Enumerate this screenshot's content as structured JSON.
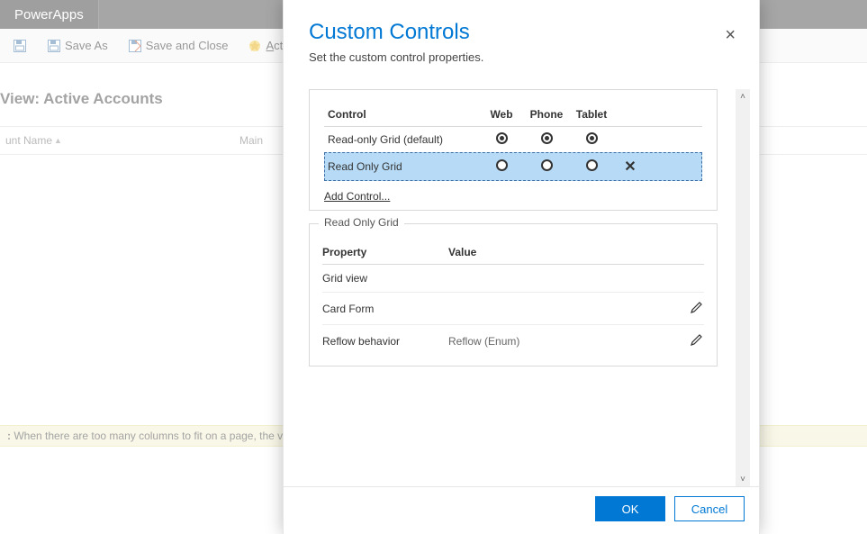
{
  "app": {
    "brand": "PowerApps"
  },
  "cmdbar": {
    "save_as": "Save As",
    "save_close": "Save and Close",
    "actions": "Actions"
  },
  "page": {
    "view_title": "View: Active Accounts",
    "columns": {
      "name": "unt Name",
      "main": "Main"
    },
    "note_label": ":",
    "note_text": " When there are too many columns to fit on a page, the view v"
  },
  "dialog": {
    "title": "Custom Controls",
    "subtitle": "Set the custom control properties.",
    "close_glyph": "×",
    "headers": {
      "control": "Control",
      "web": "Web",
      "phone": "Phone",
      "tablet": "Tablet"
    },
    "rows": [
      {
        "label": "Read-only Grid (default)",
        "web": true,
        "phone": true,
        "tablet": true,
        "deletable": false
      },
      {
        "label": "Read Only Grid",
        "web": false,
        "phone": false,
        "tablet": false,
        "deletable": true
      }
    ],
    "add_control": "Add Control...",
    "delete_glyph": "✕",
    "fieldset_title": "Read Only Grid",
    "prop_headers": {
      "property": "Property",
      "value": "Value"
    },
    "props": [
      {
        "name": "Grid view",
        "value": "",
        "editable": false
      },
      {
        "name": "Card Form",
        "value": "",
        "editable": true
      },
      {
        "name": "Reflow behavior",
        "value": "Reflow (Enum)",
        "editable": true
      }
    ],
    "ok": "OK",
    "cancel": "Cancel"
  }
}
